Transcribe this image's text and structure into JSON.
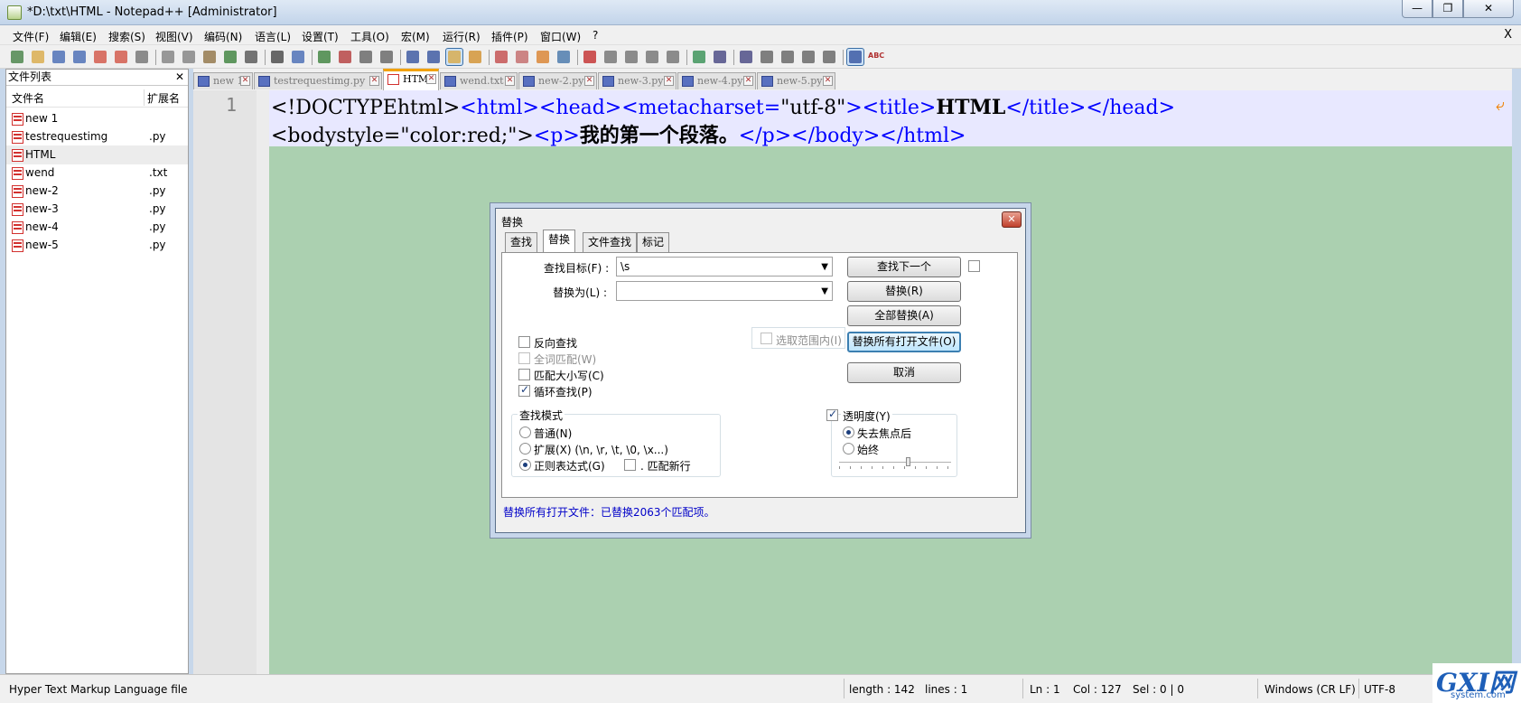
{
  "window": {
    "title": "*D:\\txt\\HTML - Notepad++ [Administrator]",
    "minimize": "—",
    "restore": "❐",
    "close": "✕"
  },
  "menu": {
    "items": [
      "文件(F)",
      "编辑(E)",
      "搜索(S)",
      "视图(V)",
      "编码(N)",
      "语言(L)",
      "设置(T)",
      "工具(O)",
      "宏(M)",
      "运行(R)",
      "插件(P)",
      "窗口(W)",
      "?"
    ],
    "close_doc": "X"
  },
  "toolbar": {
    "icons": [
      "new-file-icon",
      "open-file-icon",
      "save-icon",
      "save-all-icon",
      "close-icon",
      "close-all-icon",
      "print-icon",
      "cut-icon",
      "copy-icon",
      "paste-icon",
      "undo-icon",
      "redo-icon",
      "find-icon",
      "replace-icon",
      "zoom-in-icon",
      "zoom-out-icon",
      "sync-vertical-icon",
      "sync-horizontal-icon",
      "word-wrap-icon",
      "show-all-chars-icon",
      "indent-guide-icon",
      "user-lang-icon",
      "doc-map-icon",
      "function-list-icon",
      "folder-workspace-icon",
      "monitoring-icon",
      "record-macro-icon",
      "stop-macro-icon",
      "play-macro-icon",
      "run-macro-multiple-icon",
      "save-macro-icon",
      "plugin-icon",
      "column-icon",
      "compare-icon",
      "align-icon",
      "nav-up-icon",
      "nav-down-icon",
      "clear-icon",
      "file-panel-icon",
      "spellcheck-icon"
    ],
    "spellcheck_text": "ABC"
  },
  "file_panel": {
    "title": "文件列表",
    "close": "✕",
    "col_name": "文件名",
    "col_ext": "扩展名",
    "files": [
      {
        "name": "new 1",
        "ext": ""
      },
      {
        "name": "testrequestimg",
        "ext": ".py"
      },
      {
        "name": "HTML",
        "ext": ""
      },
      {
        "name": "wend",
        "ext": ".txt"
      },
      {
        "name": "new-2",
        "ext": ".py"
      },
      {
        "name": "new-3",
        "ext": ".py"
      },
      {
        "name": "new-4",
        "ext": ".py"
      },
      {
        "name": "new-5",
        "ext": ".py"
      }
    ]
  },
  "tabs": [
    {
      "label": "new 1",
      "active": false
    },
    {
      "label": "testrequestimg.py",
      "active": false
    },
    {
      "label": "HTML",
      "active": true
    },
    {
      "label": "wend.txt",
      "active": false
    },
    {
      "label": "new-2.py",
      "active": false
    },
    {
      "label": "new-3.py",
      "active": false
    },
    {
      "label": "new-4.py",
      "active": false
    },
    {
      "label": "new-5.py",
      "active": false
    }
  ],
  "editor": {
    "line_number": "1",
    "line1": {
      "t1": "<!DOCTYPEhtml>",
      "t2": "<html><head><metacharset=",
      "t3": "\"utf-8\"",
      "t4": "><title>",
      "t5": "HTML",
      "t6": "</title></head>"
    },
    "line2": {
      "t1": "<bodystyle=\"color:red;\">",
      "t2": "<p>",
      "t3": "我的第一个段落。",
      "t4": "</p></body></html>"
    },
    "wrap_symbol": "⤶",
    "colors": {
      "background": "#abd0b0",
      "current_line": "#e8e8ff",
      "tag": "#0000ff"
    }
  },
  "dialog": {
    "title": "替换",
    "close": "✕",
    "tabs": [
      "查找",
      "替换",
      "文件查找",
      "标记"
    ],
    "active_tab": "替换",
    "find_label": "查找目标(F) :",
    "find_value": "\\s",
    "replace_label": "替换为(L) :",
    "replace_value": "",
    "buttons": {
      "find_next": "查找下一个",
      "replace": "替换(R)",
      "replace_all": "全部替换(A)",
      "replace_all_open": "替换所有打开文件(O)",
      "cancel": "取消"
    },
    "in_selection": "选取范围内(I)",
    "options": [
      {
        "label": "反向查找",
        "checked": false,
        "disabled": false
      },
      {
        "label": "全词匹配(W)",
        "checked": false,
        "disabled": true
      },
      {
        "label": "匹配大小写(C)",
        "checked": false,
        "disabled": false
      },
      {
        "label": "循环查找(P)",
        "checked": true,
        "disabled": false
      }
    ],
    "search_mode": {
      "title": "查找模式",
      "normal": "普通(N)",
      "extended": "扩展(X) (\\n, \\r, \\t, \\0, \\x...)",
      "regex": "正则表达式(G)",
      "dot_newline": ". 匹配新行",
      "selected": "regex"
    },
    "transparency": {
      "label": "透明度(Y)",
      "checked": true,
      "on_lose_focus": "失去焦点后",
      "always": "始终",
      "selected": "on_lose_focus",
      "level": 0.62
    },
    "status": "替换所有打开文件：已替换2063个匹配项。"
  },
  "statusbar": {
    "file_type": "Hyper Text Markup Language file",
    "length": "length : 142",
    "lines": "lines : 1",
    "ln": "Ln : 1",
    "col": "Col : 127",
    "sel": "Sel : 0 | 0",
    "eol": "Windows (CR LF)",
    "encoding": "UTF-8"
  },
  "watermark": {
    "main": "GXI网",
    "sub": "system.com"
  }
}
